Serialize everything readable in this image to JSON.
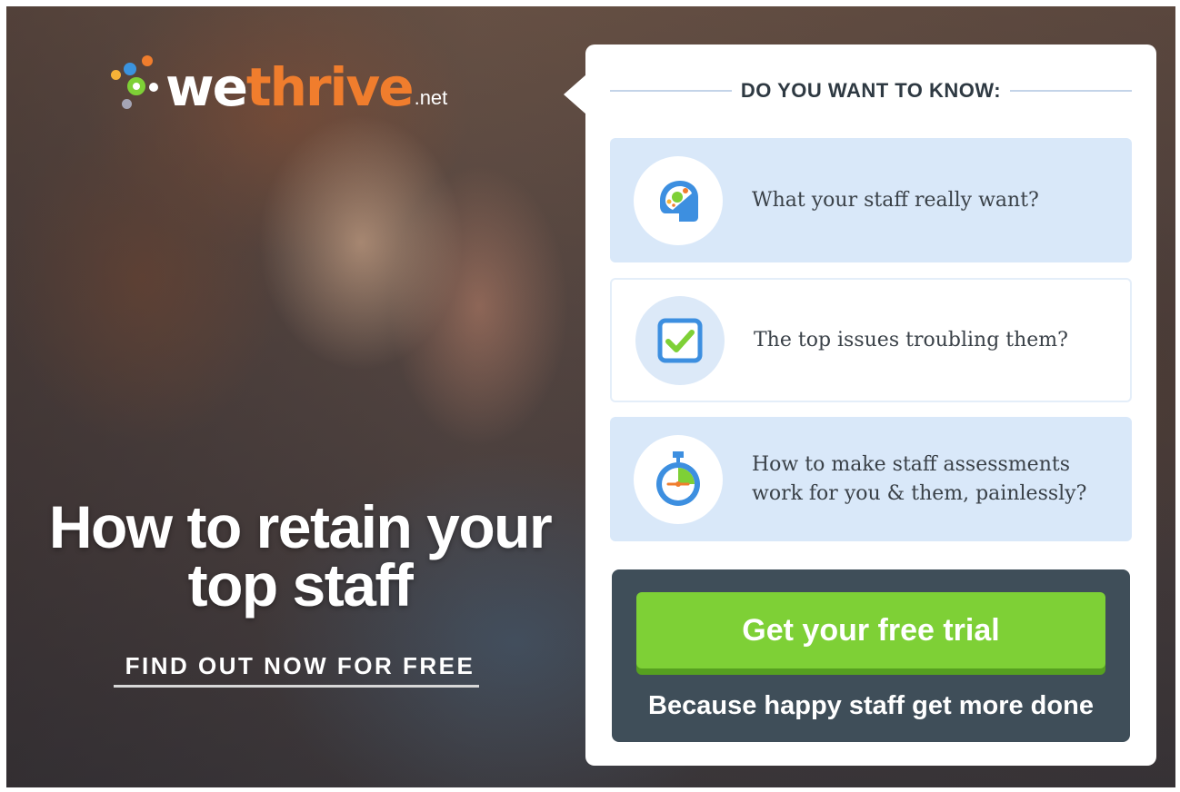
{
  "brand": {
    "logo_we": "we",
    "logo_thrive": "thrive",
    "logo_net": ".net"
  },
  "hero": {
    "headline_line1": "How to retain your",
    "headline_line2": "top staff",
    "cta_link": "FIND OUT NOW FOR FREE"
  },
  "card": {
    "title": "DO YOU WANT TO KNOW:",
    "items": [
      {
        "label": "What your staff really want?",
        "icon": "head-icon"
      },
      {
        "label": "The top issues troubling them?",
        "icon": "checkbox-icon"
      },
      {
        "label_line1": "How to make staff assessments",
        "label_line2": "work for you & them, painlessly?",
        "icon": "stopwatch-icon"
      }
    ],
    "button_label": "Get your free trial",
    "tagline": "Because happy staff get more done"
  },
  "colors": {
    "accent_orange": "#f07d2d",
    "button_green": "#7ed036",
    "panel_dark": "#3f4e59",
    "item_blue": "#d9e8f9",
    "icon_blue": "#3d8fe0"
  }
}
